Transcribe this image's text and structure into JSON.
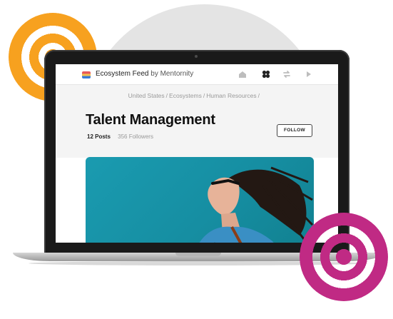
{
  "header": {
    "brand_name": "Ecosystem Feed",
    "brand_by": "by Mentornity"
  },
  "icons": [
    "home-icon",
    "grid-icon",
    "swap-icon",
    "chevron-right-icon"
  ],
  "breadcrumb": [
    "United States",
    "Ecosystems",
    "Human Resources"
  ],
  "page": {
    "title": "Talent Management",
    "posts": "12 Posts",
    "followers": "356 Followers",
    "follow_label": "FOLLOW"
  },
  "colors": {
    "orange_ring": "#f7a11f",
    "magenta_ring": "#c02a84",
    "hero_teal": "#1a9bb0"
  }
}
